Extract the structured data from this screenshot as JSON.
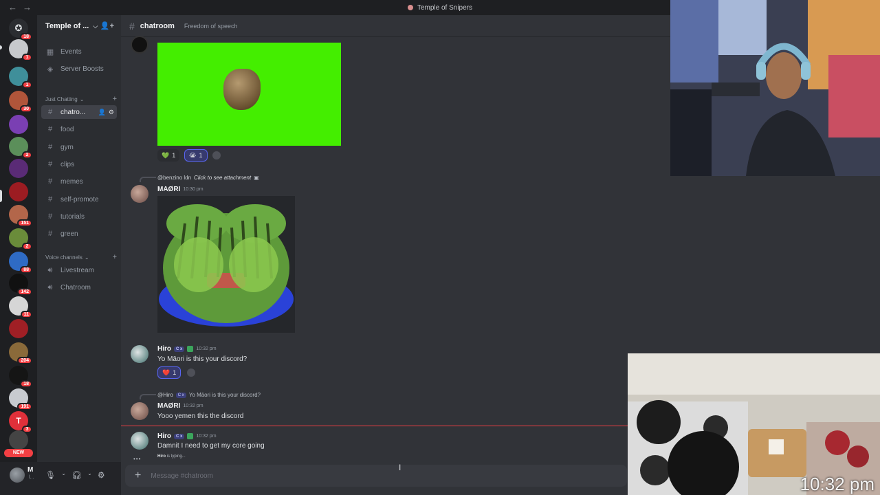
{
  "window": {
    "title": "Temple of Snipers"
  },
  "server": {
    "name": "Temple of ...",
    "items": [
      {
        "label": "Events",
        "icon": "calendar-icon"
      },
      {
        "label": "Server Boosts",
        "icon": "boost-icon"
      }
    ],
    "categories": {
      "text": "Just Chatting",
      "voice": "Voice channels"
    },
    "channels": [
      "chatro...",
      "food",
      "gym",
      "clips",
      "memes",
      "self-promote",
      "tutorials",
      "green"
    ],
    "voice_channels": [
      "Livestream",
      "Chatroom"
    ]
  },
  "rail": {
    "badges": [
      "18",
      "1",
      "1",
      "30",
      "2",
      "1",
      "151",
      "2",
      "88",
      "142",
      "11",
      "204",
      "18",
      "191",
      "3"
    ],
    "new_label": "NEW"
  },
  "user": {
    "name": "M",
    "status": "l..."
  },
  "channel": {
    "name": "chatroom",
    "topic": "Freedom of speech"
  },
  "messages": {
    "m1": {
      "reactions": [
        {
          "emoji": "💚",
          "count": "1"
        },
        {
          "emoji": "😭",
          "count": "1"
        }
      ]
    },
    "m2": {
      "reply_user": "@benzino ldn",
      "reply_text": "Click to see attachment",
      "author": "MAØRI",
      "time": "10:30 pm"
    },
    "m3": {
      "author": "Hiro",
      "role": "C x",
      "time": "10:32 pm",
      "text": "Yo Māori is this your discord?",
      "reactions": [
        {
          "emoji": "❤️",
          "count": "1"
        }
      ]
    },
    "m4": {
      "reply_user": "@Hiro",
      "reply_role": "C x",
      "reply_text": "Yo Māori is this your discord?",
      "author": "MAØRI",
      "time": "10:32 pm",
      "text": "Yooo yemen this the discord"
    },
    "m5": {
      "author": "Hiro",
      "role": "C x",
      "time": "10:32 pm",
      "text": "Damnit I need to get my core going"
    }
  },
  "typing": {
    "user": "Hiro",
    "suffix": "is typing..."
  },
  "composer": {
    "placeholder": "Message #chatroom"
  },
  "overlay": {
    "clock": "10:32 pm"
  },
  "colors": {
    "accent": "#5865f2",
    "danger": "#f23f43",
    "green_screen": "#44ee00"
  }
}
